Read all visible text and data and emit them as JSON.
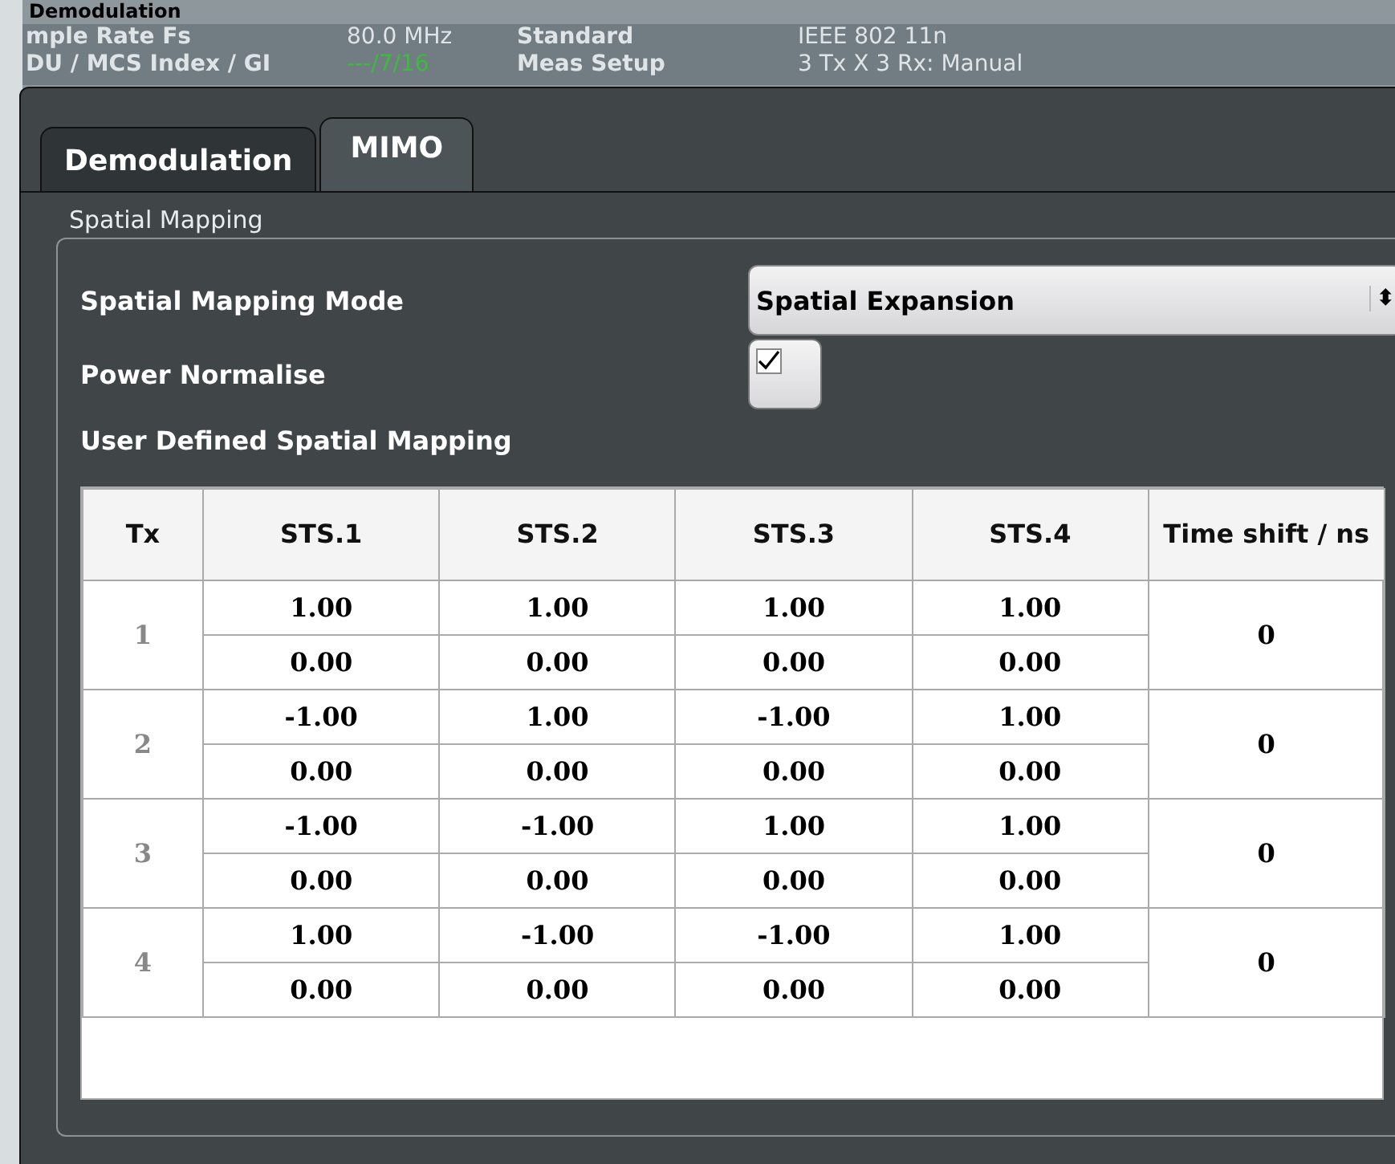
{
  "background_header": {
    "items": [
      {
        "text": "mple Rate Fs",
        "kind": "label"
      },
      {
        "text": "80.0 MHz",
        "kind": "value"
      },
      {
        "text": "Standard",
        "kind": "label"
      },
      {
        "text": "IEEE 802 11n",
        "kind": "value"
      }
    ],
    "items_row2": [
      {
        "text": "DU / MCS Index / GI",
        "kind": "label"
      },
      {
        "text": "---/7/16",
        "kind": "status"
      },
      {
        "text": "Meas Setup",
        "kind": "label"
      },
      {
        "text": "3 Tx X 3 Rx: Manual",
        "kind": "value"
      }
    ]
  },
  "dialog": {
    "title": "Demodulation"
  },
  "tabs": [
    {
      "label": "Demodulation",
      "selected": false
    },
    {
      "label": "MIMO",
      "selected": true
    }
  ],
  "group": {
    "title": "Spatial Mapping",
    "mode": {
      "label": "Spatial Mapping Mode",
      "value": "Spatial Expansion",
      "arrow": "⬍"
    },
    "power_normalise": {
      "label": "Power Normalise",
      "checked": true
    },
    "user_defined_label": "User Defined Spatial Mapping",
    "table": {
      "columns": [
        "Tx",
        "STS.1",
        "STS.2",
        "STS.3",
        "STS.4",
        "Time shift / ns"
      ],
      "rows": [
        {
          "tx": "1",
          "values": [
            [
              "1.00",
              "0.00"
            ],
            [
              "1.00",
              "0.00"
            ],
            [
              "1.00",
              "0.00"
            ],
            [
              "1.00",
              "0.00"
            ]
          ],
          "time_shift": "0"
        },
        {
          "tx": "2",
          "values": [
            [
              "-1.00",
              "0.00"
            ],
            [
              "1.00",
              "0.00"
            ],
            [
              "-1.00",
              "0.00"
            ],
            [
              "1.00",
              "0.00"
            ]
          ],
          "time_shift": "0"
        },
        {
          "tx": "3",
          "values": [
            [
              "-1.00",
              "0.00"
            ],
            [
              "-1.00",
              "0.00"
            ],
            [
              "1.00",
              "0.00"
            ],
            [
              "1.00",
              "0.00"
            ]
          ],
          "time_shift": "0"
        },
        {
          "tx": "4",
          "values": [
            [
              "1.00",
              "0.00"
            ],
            [
              "-1.00",
              "0.00"
            ],
            [
              "-1.00",
              "0.00"
            ],
            [
              "1.00",
              "0.00"
            ]
          ],
          "time_shift": "0"
        }
      ]
    }
  }
}
